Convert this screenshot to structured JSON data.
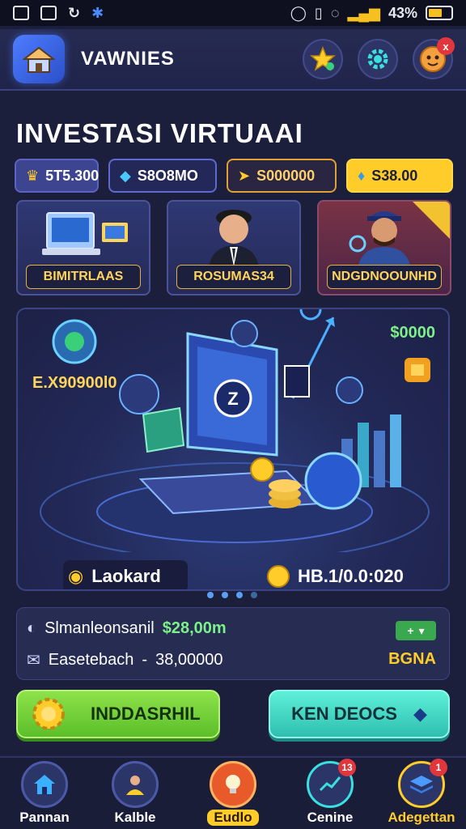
{
  "status_bar": {
    "battery": "43%",
    "icons": [
      "image-icon",
      "sim-icon",
      "sync-icon",
      "bluetooth-icon"
    ],
    "right_icons": [
      "alarm-icon",
      "vibrate-icon",
      "wifi-icon",
      "signal-icon",
      "battery-icon"
    ]
  },
  "header": {
    "title": "VAWNIES",
    "logo_icon": "house-icon",
    "actions": [
      {
        "name": "star-icon"
      },
      {
        "name": "gear-icon"
      },
      {
        "name": "avatar-icon",
        "badge": "x"
      }
    ]
  },
  "page": {
    "title": "INVESTASI VIRTUAAI"
  },
  "stats": [
    {
      "value": "5T5.300",
      "icon": "trophy-icon"
    },
    {
      "value": "S8O8MO",
      "icon": "diamond-icon"
    },
    {
      "value": "S000000",
      "icon": "ticket-icon"
    },
    {
      "value": "S38.00",
      "icon": "gem-icon"
    }
  ],
  "cards": [
    {
      "label": "BIMITRLAAS",
      "icon": "computer-icon"
    },
    {
      "label": "ROSUMAS34",
      "icon": "businessman-icon"
    },
    {
      "label": "NDGDNOOUNHD",
      "icon": "detective-icon"
    }
  ],
  "hero": {
    "amount_right": "$0000",
    "amount_left": "E.X90900l0",
    "pill_left": "Laokard",
    "pill_right": "HB.1/0.0:020",
    "dots_total": 4,
    "dots_active": 3
  },
  "info": {
    "row1_label": "Slmanleonsanil",
    "row1_value": "$28,00m",
    "row2_label": "Easetebach",
    "row2_sep": "-",
    "row2_value": "38,00000",
    "toggle": "+",
    "side_text": "BGNA"
  },
  "buttons": {
    "primary_label": "INDDASRHIL",
    "secondary_label": "KEN DEOCS"
  },
  "nav": [
    {
      "label": "Pannan",
      "icon": "home-icon"
    },
    {
      "label": "Kalble",
      "icon": "user-icon"
    },
    {
      "label": "Eudlo",
      "icon": "lightbulb-icon"
    },
    {
      "label": "Cenine",
      "icon": "chart-icon",
      "badge": "13"
    },
    {
      "label": "Adegettan",
      "icon": "layers-icon",
      "badge": "1"
    }
  ],
  "colors": {
    "background": "#1b1f3b",
    "accent_yellow": "#ffcc2a",
    "accent_green": "#7df08a",
    "primary_button": "#5bbf2a",
    "secondary_button": "#2fbfb0"
  }
}
